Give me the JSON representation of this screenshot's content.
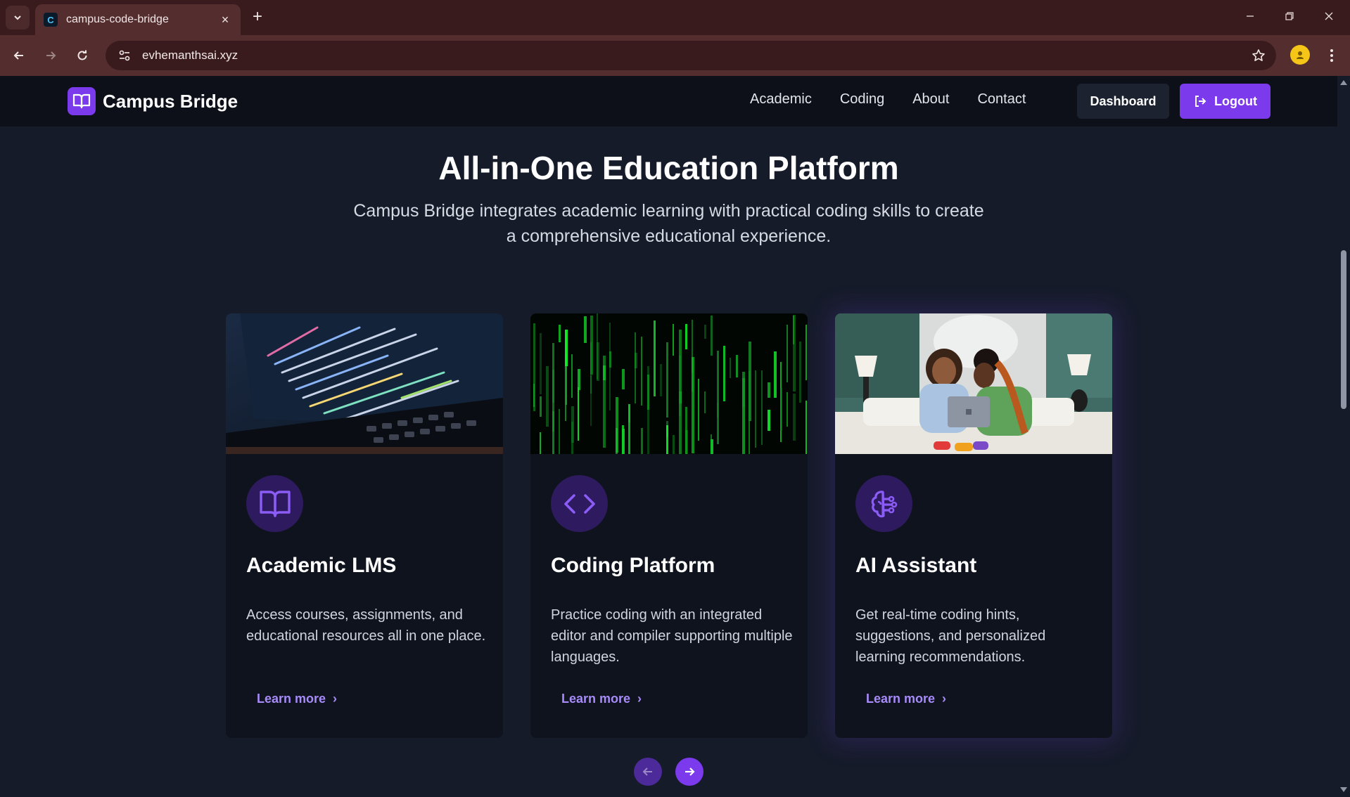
{
  "browser": {
    "tab_title": "campus-code-bridge",
    "favicon_letter": "C",
    "url": "evhemanthsai.xyz",
    "new_tab_symbol": "+",
    "close_symbol": "×"
  },
  "nav": {
    "brand": "Campus Bridge",
    "links": [
      "Academic",
      "Coding",
      "About",
      "Contact"
    ],
    "dashboard_label": "Dashboard",
    "logout_label": "Logout",
    "accent_color": "#7c3aed"
  },
  "hero": {
    "title": "All-in-One Education Platform",
    "subtitle": "Campus Bridge integrates academic learning with practical coding skills to create a comprehensive educational experience."
  },
  "cards": [
    {
      "icon": "book-open-icon",
      "title": "Academic LMS",
      "description": "Access courses, assignments, and educational resources all in one place.",
      "link": "Learn more",
      "image": "laptop-code-screen"
    },
    {
      "icon": "code-icon",
      "title": "Coding Platform",
      "description": "Practice coding with an integrated editor and compiler supporting multiple languages.",
      "link": "Learn more",
      "image": "green-matrix-code"
    },
    {
      "icon": "brain-circuit-icon",
      "title": "AI Assistant",
      "description": "Get real-time coding hints, suggestions, and personalized learning recommendations.",
      "link": "Learn more",
      "image": "two-people-with-laptop"
    }
  ]
}
